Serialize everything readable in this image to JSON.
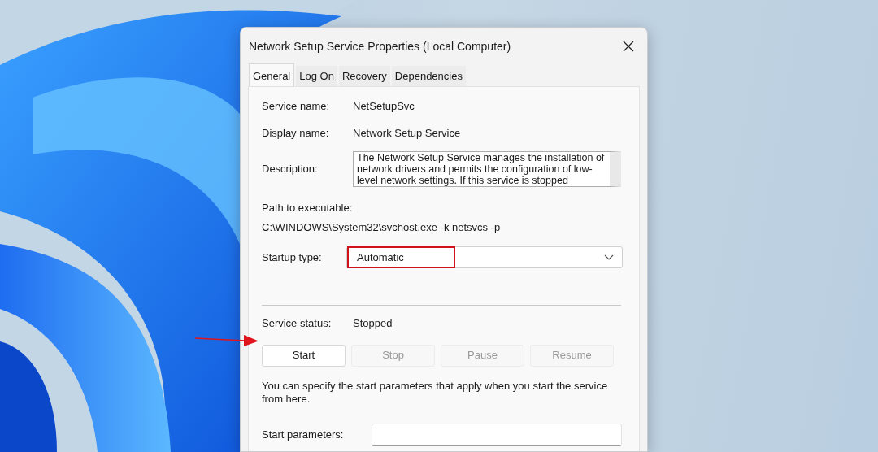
{
  "window": {
    "title": "Network Setup Service Properties (Local Computer)"
  },
  "tabs": [
    {
      "label": "General",
      "selected": true
    },
    {
      "label": "Log On",
      "selected": false
    },
    {
      "label": "Recovery",
      "selected": false
    },
    {
      "label": "Dependencies",
      "selected": false
    }
  ],
  "fields": [
    {
      "label": "Service name:",
      "value": "NetSetupSvc"
    },
    {
      "label": "Display name:",
      "value": "Network Setup Service"
    }
  ],
  "description": {
    "label": "Description:",
    "value": "The Network Setup Service manages the installation of network drivers and permits the configuration of low-level network settings.  If this service is stopped"
  },
  "path": {
    "label": "Path to executable:",
    "value": "C:\\WINDOWS\\System32\\svchost.exe -k netsvcs -p"
  },
  "startup_type": {
    "label": "Startup type:",
    "value": "Automatic",
    "highlighted": true
  },
  "service_status": {
    "label": "Service status:",
    "value": "Stopped"
  },
  "buttons": [
    {
      "label": "Start",
      "disabled": false
    },
    {
      "label": "Stop",
      "disabled": true
    },
    {
      "label": "Pause",
      "disabled": true
    },
    {
      "label": "Resume",
      "disabled": true
    }
  ],
  "start_arrow": true,
  "help_text": "You can specify the start parameters that apply when you start the service from here.",
  "start_parameters": {
    "label": "Start parameters:"
  }
}
